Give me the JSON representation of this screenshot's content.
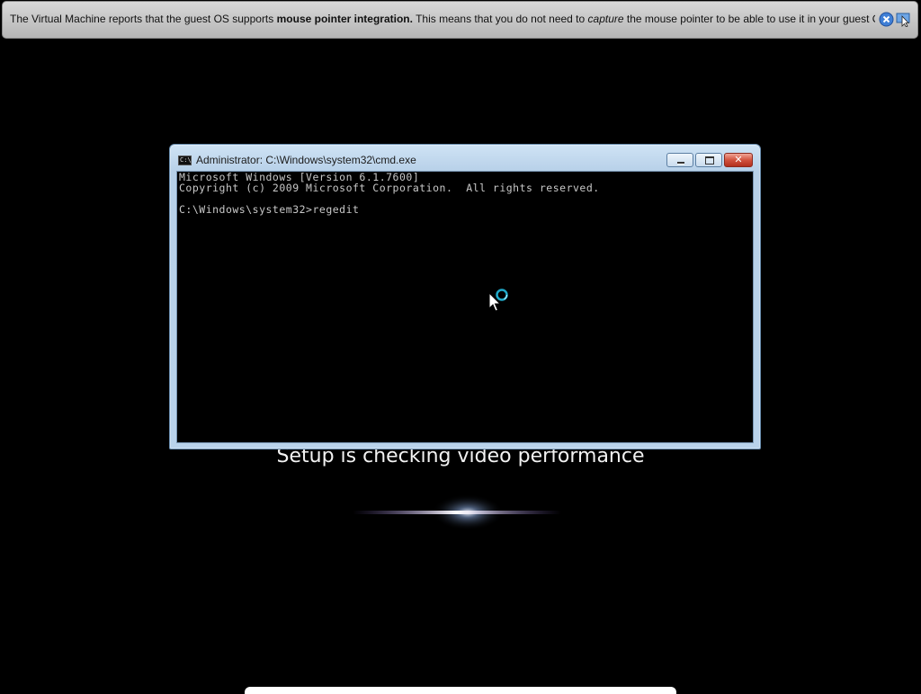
{
  "vm_notification": {
    "part1": "The Virtual Machine reports that the guest OS supports ",
    "bold": "mouse pointer integration.",
    "part2": " This means that you do not need to ",
    "italic": "capture",
    "part3": " the mouse pointer to be able to use it in your guest OS -- all mouse",
    "close_icon": "close-circle-icon",
    "pointer_icon": "mouse-integration-icon"
  },
  "cmd": {
    "title": "Administrator: C:\\Windows\\system32\\cmd.exe",
    "icon_label": "C:\\",
    "output": "Microsoft Windows [Version 6.1.7600]\nCopyright (c) 2009 Microsoft Corporation.  All rights reserved.\n\nC:\\Windows\\system32>regedit"
  },
  "setup": {
    "status": "Setup is checking video performance"
  },
  "colors": {
    "background": "#000000",
    "glow": "#b9a6ff",
    "console_text": "#c8c8c8"
  }
}
